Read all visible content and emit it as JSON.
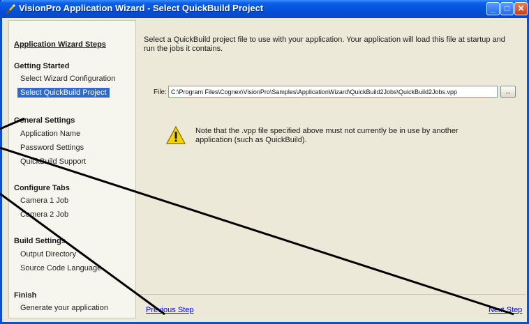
{
  "window": {
    "title": "VisionPro Application Wizard - Select QuickBuild Project",
    "minimize_glyph": "_",
    "maximize_glyph": "□",
    "close_glyph": "✕"
  },
  "sidebar": {
    "title": "Application Wizard Steps",
    "sections": [
      {
        "heading": "Getting Started",
        "items": [
          {
            "label": "Select Wizard Configuration"
          },
          {
            "label": "Select QuickBuild Project",
            "selected": true
          }
        ]
      },
      {
        "heading": "General Settings",
        "items": [
          {
            "label": "Application Name"
          },
          {
            "label": "Password Settings"
          },
          {
            "label": "QuickBuild Support"
          }
        ]
      },
      {
        "heading": "Configure Tabs",
        "items": [
          {
            "label": "Camera 1 Job"
          },
          {
            "label": "Camera 2 Job"
          }
        ]
      },
      {
        "heading": "Build Settings",
        "items": [
          {
            "label": "Output Directory"
          },
          {
            "label": "Source Code Language"
          }
        ]
      },
      {
        "heading": "Finish",
        "items": [
          {
            "label": "Generate your application"
          }
        ]
      }
    ]
  },
  "main": {
    "instructions": "Select a QuickBuild project file to use with your application.  Your application will load this file at startup and run the jobs it contains.",
    "file_label": "File:",
    "file_value": "C:\\Program Files\\Cognex\\VisionPro\\Samples\\ApplicationWizard\\QuickBuild2Jobs\\QuickBuild2Jobs.vpp",
    "browse_label": "...",
    "warning": "Note that the .vpp file specified above must not currently be in use by another application (such as QuickBuild).",
    "previous_label": "Previous Step",
    "next_label": "Next Step"
  },
  "colors": {
    "title_bar": "#0450d8",
    "selection": "#316ac5",
    "link": "#0000ee",
    "window_bg": "#ece9d8"
  }
}
